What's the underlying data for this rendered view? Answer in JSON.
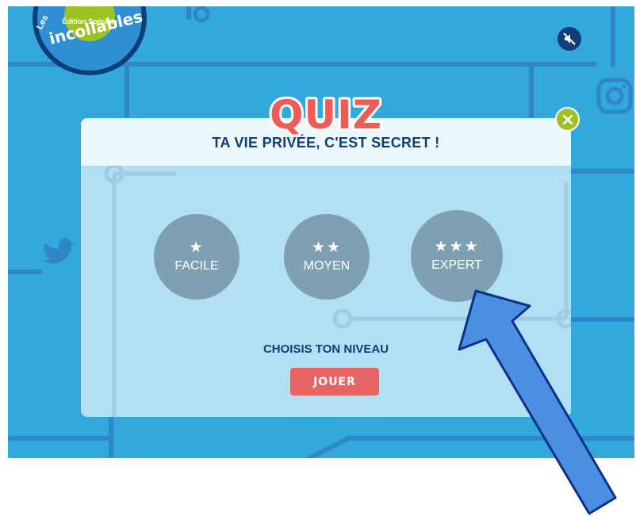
{
  "header": {
    "logo_badge": "Édition Spéciale",
    "logo_prefix": "Les",
    "logo_text": "incollables",
    "mute_icon": "speaker-muted-icon"
  },
  "quiz": {
    "logo_text": "QUIZ",
    "title": "TA VIE PRIVÉE, C'EST SECRET !",
    "close_icon": "close-icon",
    "levels": [
      {
        "stars": "★",
        "label": "FACILE"
      },
      {
        "stars": "★★",
        "label": "MOYEN"
      },
      {
        "stars": "★★★",
        "label": "EXPERT"
      }
    ],
    "instruction": "CHOISIS TON NIVEAU",
    "play_label": "JOUER"
  },
  "background": {
    "social_icons": [
      "instagram-icon",
      "twitter-icon"
    ]
  },
  "annotation": {
    "arrow_icon": "pointer-arrow-icon",
    "color": "#4a8fe0"
  },
  "colors": {
    "background": "#33a8db",
    "title": "#0e3e7a",
    "level_button": "#7f9fb3",
    "play_button": "#e86464",
    "close_button": "#9cc321"
  }
}
